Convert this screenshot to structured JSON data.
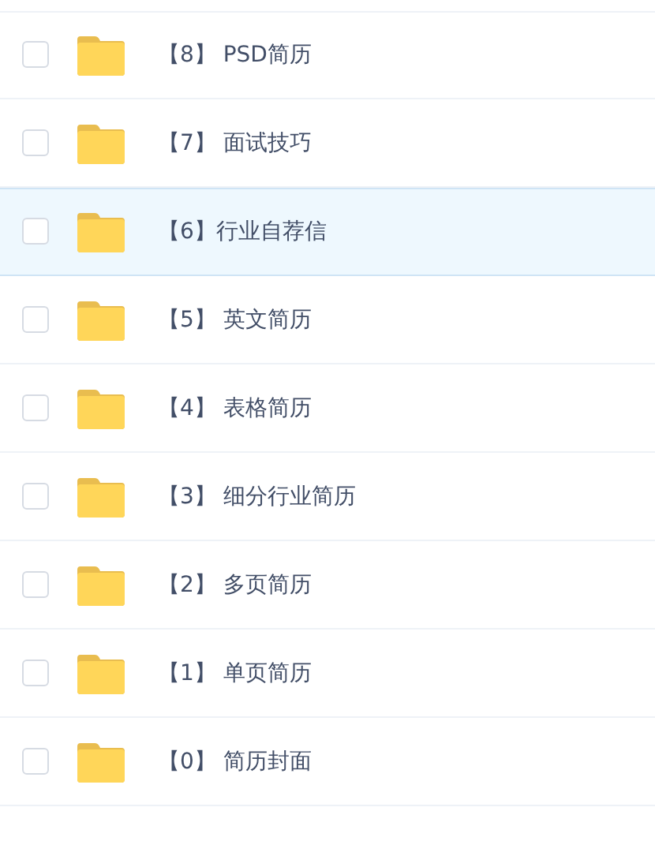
{
  "files": [
    {
      "name": "【8】 PSD简历",
      "checked": false,
      "selected": false
    },
    {
      "name": "【7】 面试技巧",
      "checked": false,
      "selected": false
    },
    {
      "name": "【6】行业自荐信",
      "checked": false,
      "selected": true
    },
    {
      "name": "【5】 英文简历",
      "checked": false,
      "selected": false
    },
    {
      "name": "【4】 表格简历",
      "checked": false,
      "selected": false
    },
    {
      "name": "【3】 细分行业简历",
      "checked": false,
      "selected": false
    },
    {
      "name": "【2】 多页简历",
      "checked": false,
      "selected": false
    },
    {
      "name": "【1】 单页简历",
      "checked": false,
      "selected": false
    },
    {
      "name": "【0】 简历封面",
      "checked": false,
      "selected": false
    }
  ]
}
